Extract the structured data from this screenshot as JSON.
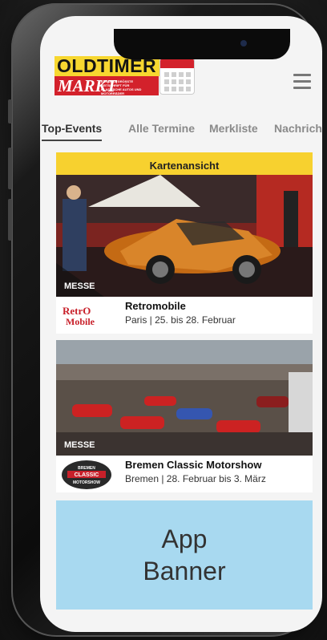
{
  "header": {
    "logo_top": "OLDTIMER",
    "logo_bottom": "MARKT",
    "logo_tagline": "EUROPAS GRÖSSTE ZEITSCHRIFT FÜR KLASSISCHE AUTOS UND MOTORRÄDER"
  },
  "tabs": [
    {
      "label": "Top-Events",
      "active": true
    },
    {
      "label": "Alle Termine",
      "active": false
    },
    {
      "label": "Merkliste",
      "active": false
    },
    {
      "label": "Nachrichten",
      "active": false
    }
  ],
  "map_button": "Kartenansicht",
  "events": [
    {
      "badge": "MESSE",
      "title": "Retromobile",
      "subtitle": "Paris | 25. bis 28. Februar",
      "logo_text": "RetrO Mobile"
    },
    {
      "badge": "MESSE",
      "title": "Bremen Classic Motorshow",
      "subtitle": "Bremen | 28. Februar bis 3. März",
      "logo_text": [
        "BREMEN",
        "CLASSIC",
        "MOTORSHOW"
      ]
    }
  ],
  "banner": {
    "line1": "App",
    "line2": "Banner"
  },
  "colors": {
    "yellow": "#f7d12f",
    "red": "#d3212b",
    "banner_blue": "#a8d9f0"
  }
}
